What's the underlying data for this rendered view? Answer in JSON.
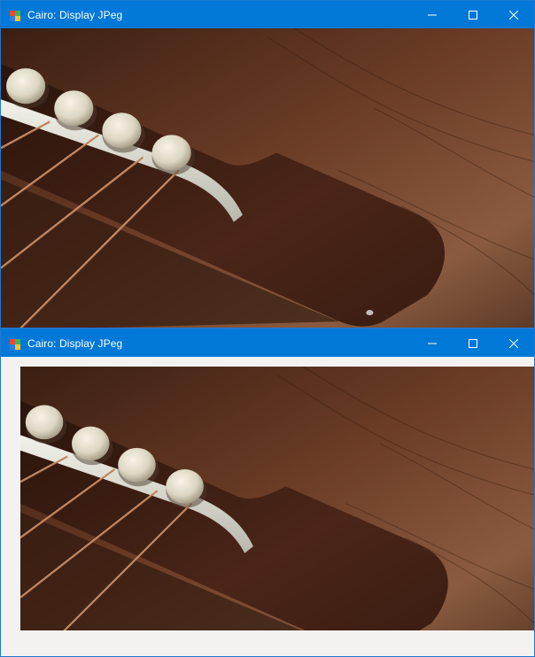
{
  "windows": [
    {
      "title": "Cairo: Display JPeg",
      "controls": [
        "minimize-icon",
        "maximize-icon",
        "close-icon"
      ],
      "image_description": "photo of wooden guitar bridge with strings and bridge pins"
    },
    {
      "title": "Cairo: Display JPeg",
      "controls": [
        "minimize-icon",
        "maximize-icon",
        "close-icon"
      ],
      "image_description": "photo of wooden guitar bridge with strings and bridge pins, offset within client area"
    }
  ],
  "colors": {
    "titlebar": "#0078d7",
    "client_background": "#f3f2f1"
  }
}
